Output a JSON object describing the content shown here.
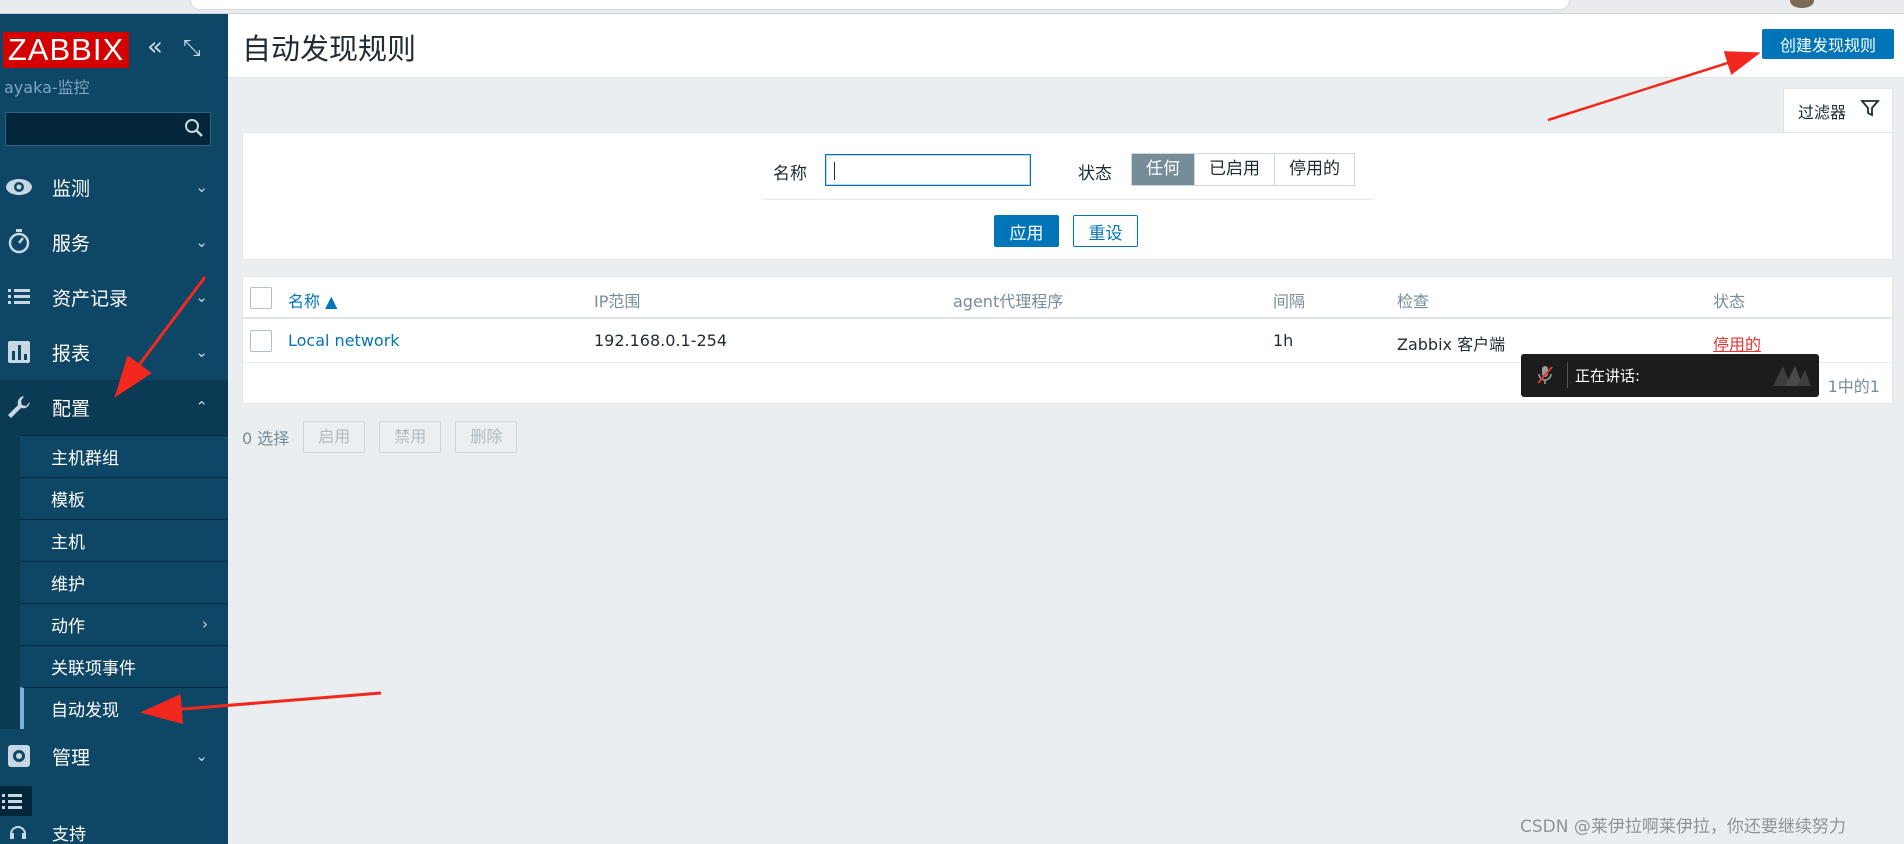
{
  "brand": {
    "logo_text": "ZABBIX",
    "server_name": "ayaka-监控",
    "logo_color": "#d40000"
  },
  "sidebar": {
    "collapse_icon": "double-chevron-left-icon",
    "kiosk_icon": "expand-icon",
    "search_placeholder": "",
    "menu": [
      {
        "label": "监测",
        "icon": "eye-icon"
      },
      {
        "label": "服务",
        "icon": "stopwatch-icon"
      },
      {
        "label": "资产记录",
        "icon": "list-icon"
      },
      {
        "label": "报表",
        "icon": "bar-chart-icon"
      },
      {
        "label": "配置",
        "icon": "wrench-icon"
      }
    ],
    "config_sub": [
      {
        "label": "主机群组"
      },
      {
        "label": "模板"
      },
      {
        "label": "主机"
      },
      {
        "label": "维护"
      },
      {
        "label": "动作"
      },
      {
        "label": "关联项事件"
      },
      {
        "label": "自动发现"
      }
    ],
    "admin": {
      "label": "管理",
      "icon": "gear-icon"
    },
    "support": {
      "label": "支持",
      "icon": "headset-icon"
    }
  },
  "header": {
    "title": "自动发现规则",
    "create_button": "创建发现规则"
  },
  "filter": {
    "tab_label": "过滤器",
    "name_label": "名称",
    "name_value": "",
    "status_label": "状态",
    "status_options": [
      "任何",
      "已启用",
      "停用的"
    ],
    "status_selected": "任何",
    "apply": "应用",
    "reset": "重设"
  },
  "table": {
    "columns": [
      "名称 ▲",
      "IP范围",
      "agent代理程序",
      "间隔",
      "检查",
      "状态"
    ],
    "rows": [
      {
        "name": "Local network",
        "ip_range": "192.168.0.1-254",
        "proxy": "",
        "interval": "1h",
        "checks": "Zabbix 客户端",
        "status": "停用的"
      }
    ],
    "count_text": "1中的1"
  },
  "mass": {
    "selected": "0 选择",
    "enable": "启用",
    "disable": "禁用",
    "delete": "删除"
  },
  "overlay": {
    "speaking_text": "正在讲话:"
  },
  "watermark": "CSDN @莱伊拉啊莱伊拉，你还要继续努力",
  "colors": {
    "accent": "#0275b8",
    "sidebar": "#0e4665",
    "danger": "#e33734",
    "arrow": "#f2281e"
  }
}
